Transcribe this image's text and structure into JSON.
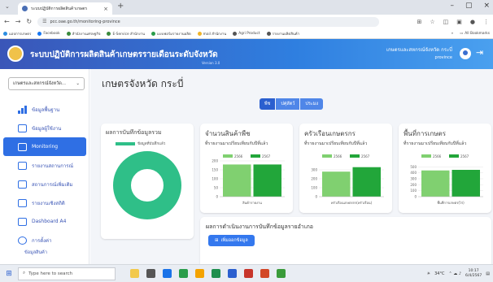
{
  "browser": {
    "tab_title": "ระบบปฏิบัติการผลิตสินค้าเกษตร",
    "url": "pcc.oae.go.th/monitoring-province",
    "bookmarks": [
      "แอปการเกษตร",
      "Facebook",
      "สำนักงานเศรษฐกิจ",
      "E-Service สำนักงาน",
      "แบบฟอร์มรายงานผลิต",
      "mail สำนักงาน",
      "Agri Product",
      "รายงานผลิตสินค้า"
    ],
    "all_bookmarks": "All Bookmarks"
  },
  "app": {
    "title": "ระบบปฏิบัติการผลิตสินค้าเกษตรรายเดือนระดับจังหวัด",
    "version": "Version 3.0",
    "user_name": "เกษตรและสหกรณ์จังหวัด กระบี่",
    "user_role": "province"
  },
  "sidebar": {
    "province_select": "เกษตรและสหกรณ์จังหวัด...",
    "items": [
      {
        "label": "ข้อมูลพื้นฐาน"
      },
      {
        "label": "ข้อมูลผู้ใช้งาน"
      },
      {
        "label": "Monitoring"
      },
      {
        "label": "รายงานสถานการณ์"
      },
      {
        "label": "สถานการณ์เพิ่มเติม"
      },
      {
        "label": "รายงานเชิงสถิติ"
      },
      {
        "label": "Dashboard A4"
      },
      {
        "label": "การตั้งค่า"
      }
    ],
    "sub_item": "ข้อมูลสินค้า"
  },
  "main": {
    "page_title": "เกษตรจังหวัด กระบี่",
    "filters": [
      "พืช",
      "ปศุสัตว์",
      "ประมง"
    ],
    "summary_card": {
      "title": "ผลการบันทึกข้อมูลรวม",
      "legend": "ข้อมูลที่บันทึกแล้ว",
      "accent": "#2fbf88"
    },
    "metric_cards": [
      {
        "title": "จำนวนสินค้าพืช",
        "subtitle": "ที่รายงานมาเปรียบเทียบกับปีที่แล้ว",
        "xlabel": "สินค้ารายงาน"
      },
      {
        "title": "ครัวเรือนเกษตรกร",
        "subtitle": "ที่รายงานมาเปรียบเทียบกับปีที่แล้ว",
        "xlabel": "ครัวเรือนเกษตรกร(ครัวเรือน)"
      },
      {
        "title": "พื้นที่การเกษตร",
        "subtitle": "ที่รายงานมาเปรียบเทียบกับปีที่แล้ว",
        "xlabel": "พื้นที่การเกษตร(ไร่)"
      }
    ],
    "district_card": {
      "title": "ผลการดำเนินงานการบันทึกข้อมูลรายอำเภอ",
      "button": "เพิ่มออกข้อมูล"
    }
  },
  "chart_data": [
    {
      "type": "pie",
      "categories": [
        "ข้อมูลที่บันทึกแล้ว"
      ],
      "values": [
        100
      ]
    },
    {
      "type": "bar",
      "categories": [
        "สินค้ารายงาน"
      ],
      "series": [
        {
          "name": "2566",
          "values": [
            180
          ]
        },
        {
          "name": "2567",
          "values": [
            180
          ]
        }
      ],
      "xlabel": "สินค้ารายงาน",
      "yticks": [
        0,
        50,
        100,
        150,
        200
      ],
      "ylim": [
        0,
        200
      ]
    },
    {
      "type": "bar",
      "categories": [
        "ครัวเรือนเกษตรกร"
      ],
      "series": [
        {
          "name": "2566",
          "values": [
            280
          ]
        },
        {
          "name": "2567",
          "values": [
            330
          ]
        }
      ],
      "xlabel": "ครัวเรือนเกษตรกร(ครัวเรือน)",
      "yticks": [
        0,
        100,
        200,
        300
      ],
      "ylim": [
        0,
        400
      ]
    },
    {
      "type": "bar",
      "categories": [
        "พื้นที่การเกษตร"
      ],
      "series": [
        {
          "name": "2566",
          "values": [
            440
          ]
        },
        {
          "name": "2567",
          "values": [
            450
          ]
        }
      ],
      "xlabel": "พื้นที่การเกษตร(ไร่)",
      "yticks": [
        0,
        100,
        200,
        300,
        400,
        500
      ],
      "ylim": [
        0,
        600
      ]
    }
  ],
  "series_colors": [
    "#80d070",
    "#22a63a"
  ],
  "taskbar": {
    "search_placeholder": "Type here to search",
    "weather": "34°C",
    "time": "10:17",
    "date": "6/4/2567"
  }
}
